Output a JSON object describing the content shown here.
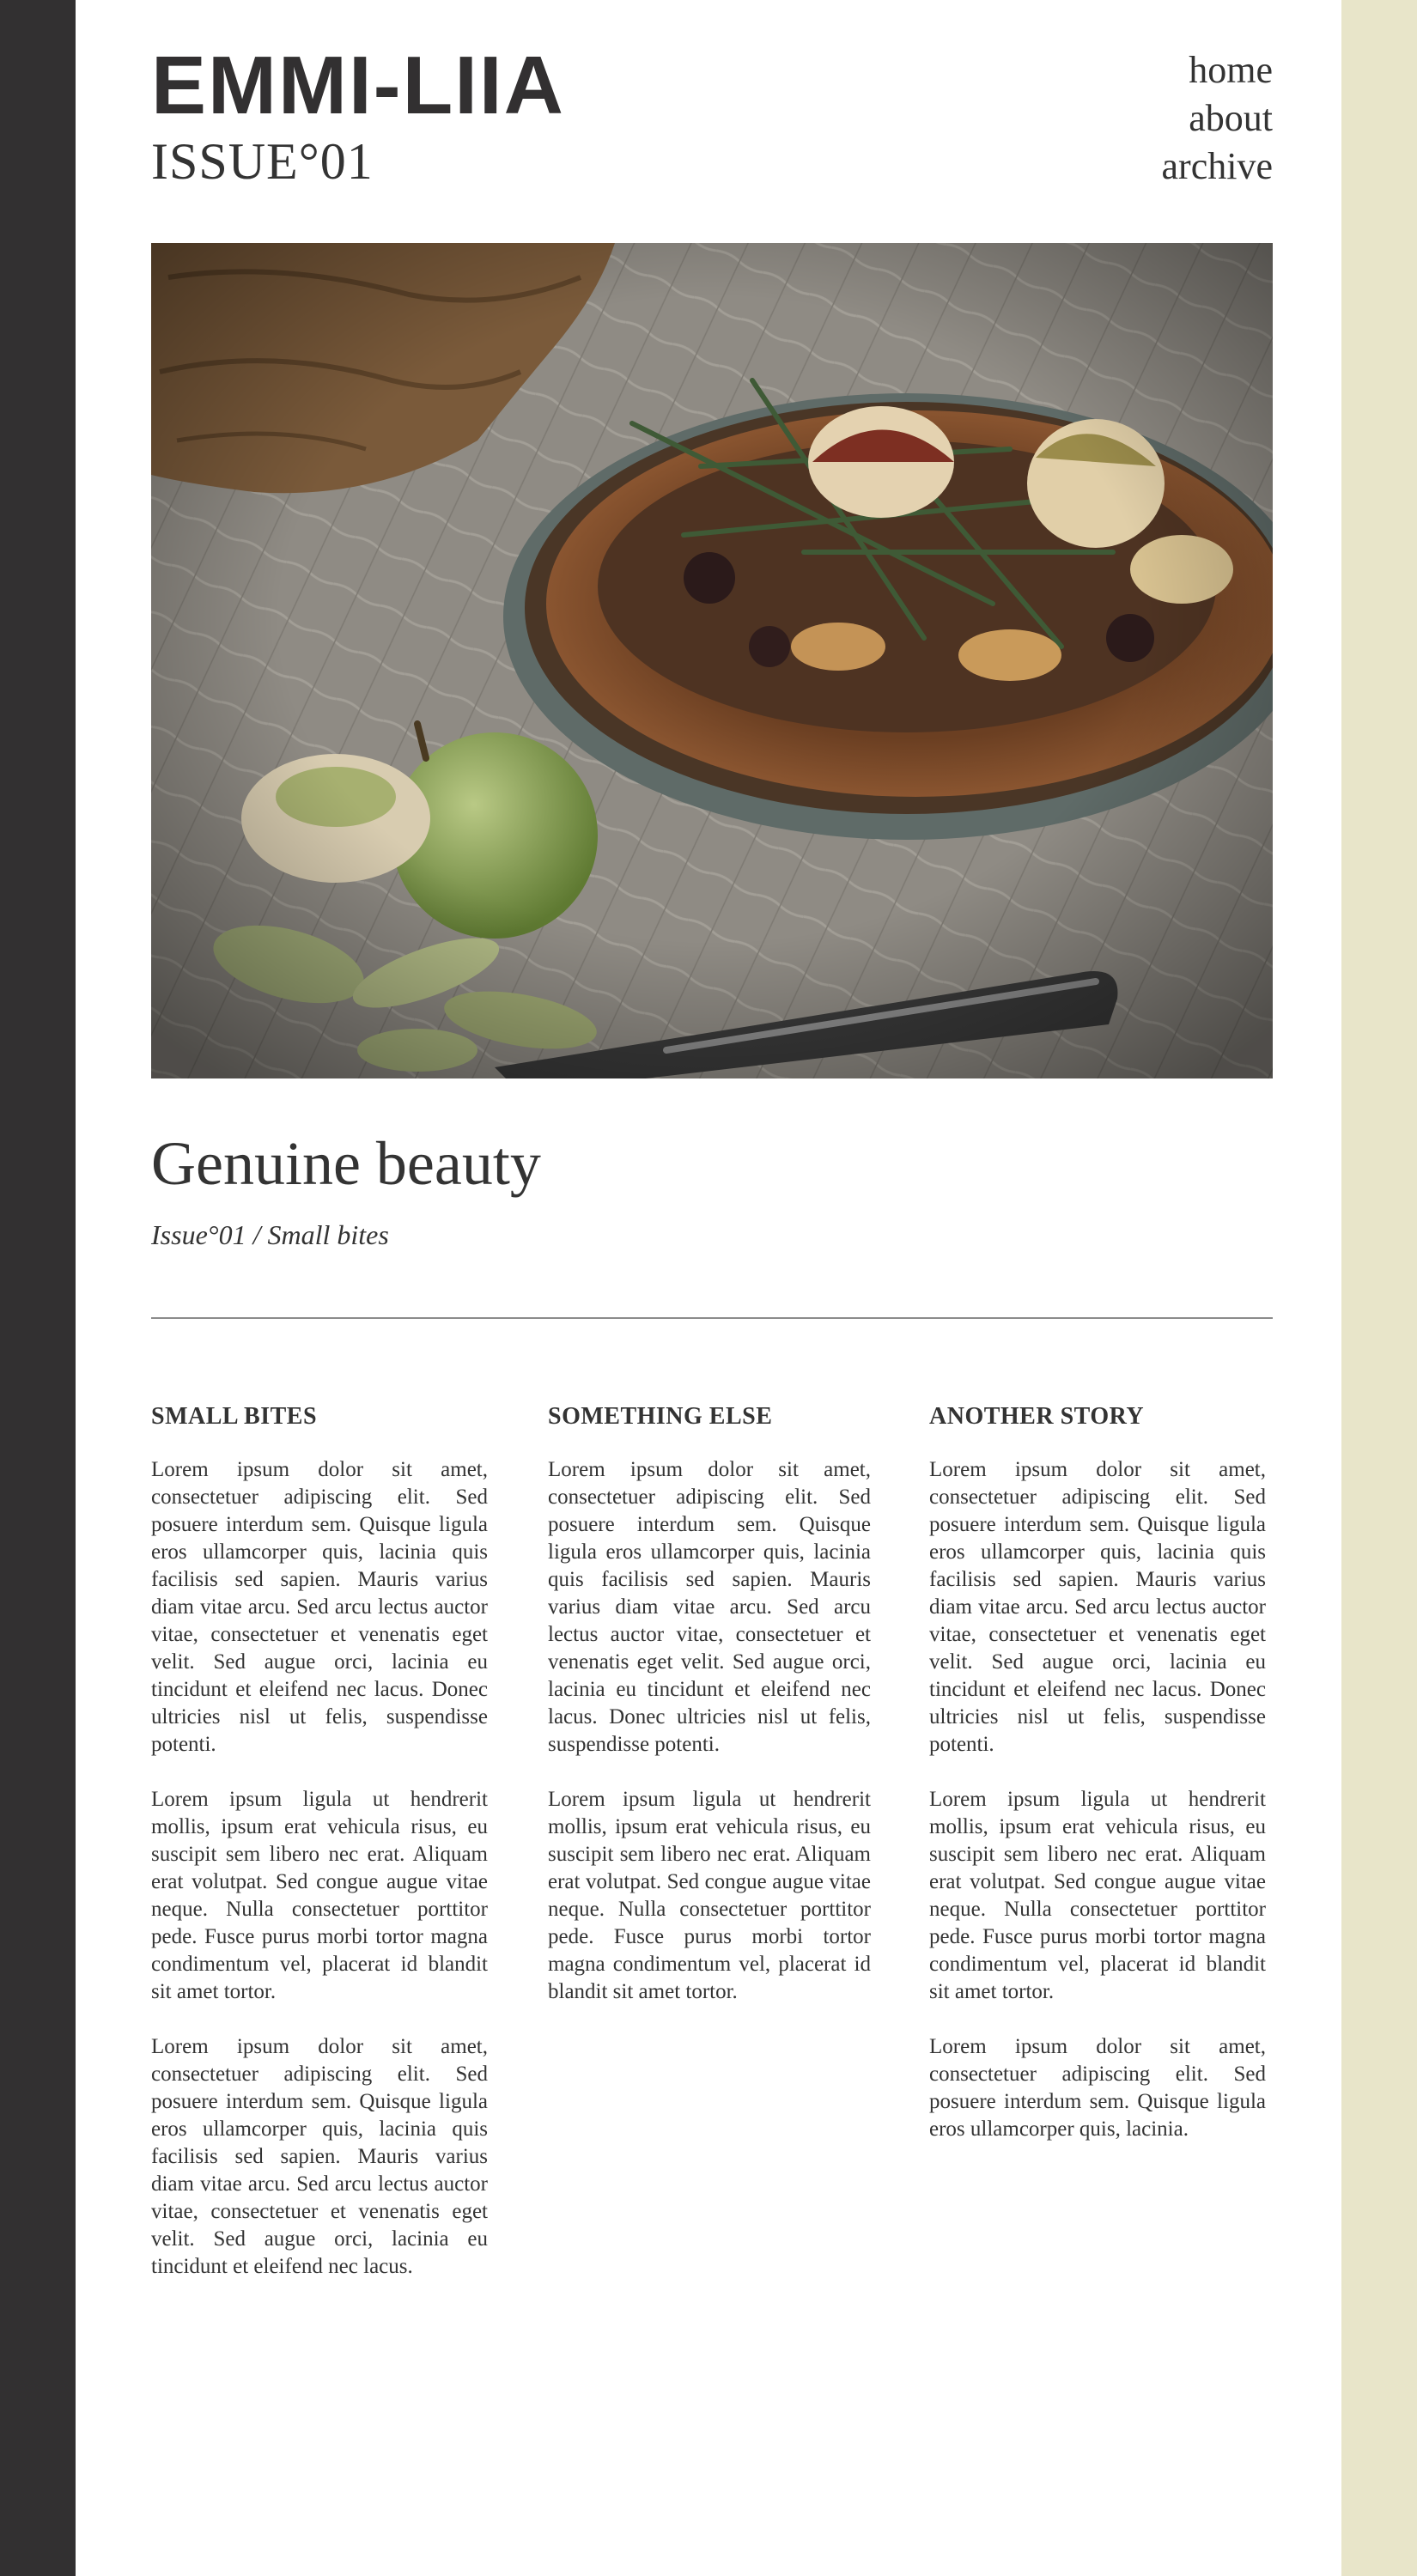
{
  "brand": {
    "logo": "EMMI-LIIA",
    "issue": "ISSUE°01"
  },
  "nav": {
    "items": [
      {
        "label": "home"
      },
      {
        "label": "about"
      },
      {
        "label": "archive"
      }
    ]
  },
  "colors": {
    "left_bar": "#323031",
    "right_bar": "#e8e5c9",
    "text": "#333333"
  },
  "article": {
    "title": "Genuine beauty",
    "subtitle": "Issue°01 / Small bites"
  },
  "columns": [
    {
      "heading": "SMALL BITES",
      "paragraphs": [
        "Lorem ipsum dolor sit amet, consectetuer adipiscing elit. Sed posuere interdum sem. Quisque ligula eros ullamcorper quis, lacinia quis facilisis sed sapien. Mauris varius diam vitae arcu. Sed arcu lectus auctor vitae, consectetuer et venenatis eget velit. Sed augue orci, lacinia eu tincidunt et eleifend nec lacus. Donec ultricies nisl ut felis, suspendisse potenti.",
        "Lorem ipsum ligula ut hendrerit mollis, ipsum erat vehicula risus, eu suscipit sem libero nec erat. Aliquam erat volutpat. Sed congue augue vitae neque. Nulla consectetuer porttitor pede. Fusce purus morbi tortor magna condimentum vel, placerat id blandit sit amet tortor.",
        "Lorem ipsum dolor sit amet, consectetuer adipiscing elit. Sed posuere interdum sem. Quisque ligula eros ullamcorper quis, lacinia quis facilisis sed sapien. Mauris varius diam vitae arcu. Sed arcu lectus auctor vitae, consectetuer et venenatis eget velit. Sed augue orci, lacinia eu tincidunt et eleifend nec lacus."
      ]
    },
    {
      "heading": "SOMETHING ELSE",
      "paragraphs": [
        "Lorem ipsum dolor sit amet, consectetuer adipiscing elit. Sed posuere interdum sem. Quisque ligula eros ullamcorper quis, lacinia quis facilisis sed sapien. Mauris varius diam vitae arcu. Sed arcu lectus auctor vitae, consectetuer et venenatis eget velit. Sed augue orci, lacinia eu tincidunt et eleifend nec lacus. Donec ultricies nisl ut felis, suspendisse potenti.",
        "Lorem ipsum ligula ut hendrerit mollis, ipsum erat vehicula risus, eu suscipit sem libero nec erat. Aliquam erat volutpat. Sed congue augue vitae neque. Nulla consectetuer porttitor pede. Fusce purus morbi tortor magna condimentum vel, placerat id blandit sit amet tortor."
      ]
    },
    {
      "heading": "ANOTHER STORY",
      "paragraphs": [
        "Lorem ipsum dolor sit amet, consectetuer adipiscing elit. Sed posuere interdum sem. Quisque ligula eros ullamcorper quis, lacinia quis facilisis sed sapien. Mauris varius diam vitae arcu. Sed arcu lectus auctor vitae, consectetuer et venenatis eget velit. Sed augue orci, lacinia eu tincidunt et eleifend nec lacus. Donec ultricies nisl ut felis, suspendisse potenti.",
        "Lorem ipsum ligula ut hendrerit mollis, ipsum erat vehicula risus, eu suscipit sem libero nec erat. Aliquam erat volutpat. Sed congue augue vitae neque. Nulla consectetuer porttitor pede. Fusce purus morbi tortor magna condimentum vel, placerat id blandit sit amet tortor.",
        "Lorem ipsum dolor sit amet, consectetuer adipiscing elit. Sed posuere interdum sem. Quisque ligula eros ullamcorper quis, lacinia."
      ]
    }
  ]
}
